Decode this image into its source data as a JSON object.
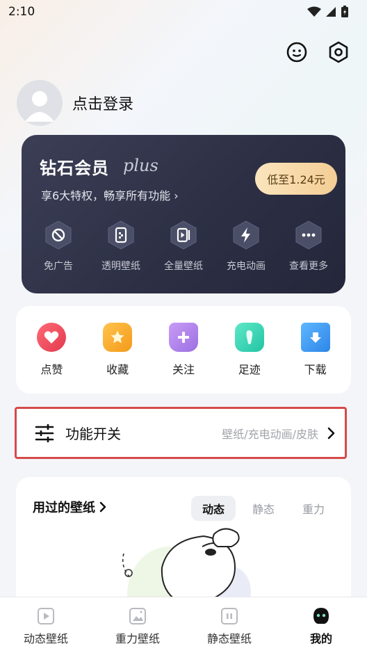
{
  "status_bar": {
    "time": "2:10"
  },
  "profile": {
    "login_text": "点击登录"
  },
  "vip": {
    "title": "钻石会员",
    "plus": "plus",
    "subtitle": "享6大特权，畅享所有功能 ›",
    "price": "低至1.24元",
    "features": [
      {
        "label": "免广告",
        "icon": "no-ads-icon"
      },
      {
        "label": "透明壁纸",
        "icon": "transparent-wallpaper-icon"
      },
      {
        "label": "全量壁纸",
        "icon": "full-wallpaper-icon"
      },
      {
        "label": "充电动画",
        "icon": "charging-icon"
      },
      {
        "label": "查看更多",
        "icon": "more-icon"
      }
    ]
  },
  "quick": [
    {
      "label": "点赞",
      "icon": "heart-icon",
      "color": "#ee4a59"
    },
    {
      "label": "收藏",
      "icon": "star-icon",
      "color": "#f5a623"
    },
    {
      "label": "关注",
      "icon": "follow-icon",
      "color": "#a57be8"
    },
    {
      "label": "足迹",
      "icon": "footprint-icon",
      "color": "#2dd4b2"
    },
    {
      "label": "下载",
      "icon": "download-icon",
      "color": "#3b9cf0"
    }
  ],
  "function_switch": {
    "title": "功能开关",
    "desc": "壁纸/充电动画/皮肤"
  },
  "used": {
    "title": "用过的壁纸",
    "tabs": [
      "动态",
      "静态",
      "重力"
    ],
    "active_tab": "动态"
  },
  "tabbar": [
    {
      "label": "动态壁纸",
      "icon": "dynamic-wallpaper-icon"
    },
    {
      "label": "重力壁纸",
      "icon": "gravity-wallpaper-icon"
    },
    {
      "label": "静态壁纸",
      "icon": "static-wallpaper-icon"
    },
    {
      "label": "我的",
      "icon": "profile-icon",
      "active": true
    }
  ]
}
